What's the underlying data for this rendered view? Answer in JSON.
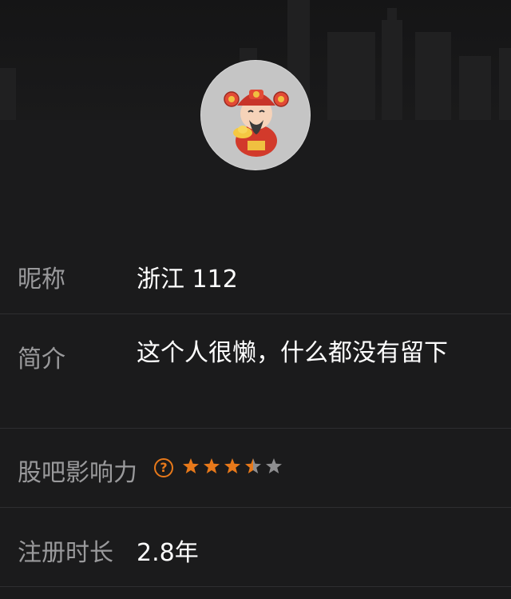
{
  "profile": {
    "avatar_icon": "caishen-cartoon-icon",
    "nickname_label": "昵称",
    "nickname_value": "浙江 112",
    "bio_label": "简介",
    "bio_value": "这个人很懒，什么都没有留下",
    "influence_label": "股吧影响力",
    "influence_help_icon": "question-circle-icon",
    "influence_rating": 3.5,
    "influence_rating_max": 5,
    "registration_label": "注册时长",
    "registration_value": "2.8年"
  },
  "colors": {
    "background": "#1b1b1c",
    "label": "#9a9a9c",
    "value": "#ffffff",
    "accent_orange": "#e8791a",
    "star_filled": "#e8791a",
    "star_empty": "#8e8e90"
  }
}
